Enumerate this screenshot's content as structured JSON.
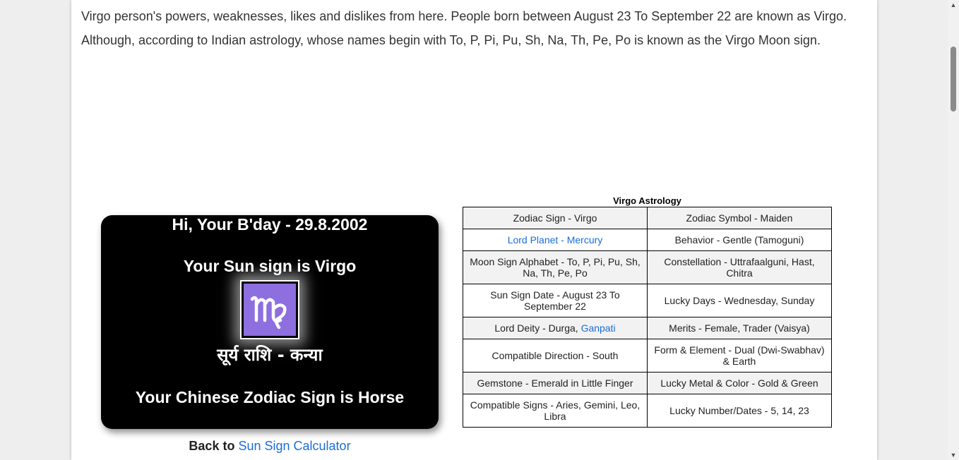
{
  "intro": {
    "text": "Virgo person's powers, weaknesses, likes and dislikes from here. People born between August 23 To September 22 are known as Virgo. Although, according to Indian astrology, whose names begin with To, P, Pi, Pu, Sh, Na, Th, Pe, Po is known as the Virgo Moon sign."
  },
  "card": {
    "birthday": "Hi, Your B'day - 29.8.2002",
    "sun_sign": "Your Sun sign is Virgo",
    "symbol_icon": "virgo-symbol-icon",
    "hindi": "सूर्य राशि - कन्या",
    "chinese": "Your Chinese Zodiac Sign is Horse",
    "symbol_color": "#8d6fe0"
  },
  "back": {
    "prefix": "Back to",
    "link": "Sun Sign Calculator"
  },
  "table": {
    "caption": "Virgo Astrology",
    "rows": [
      {
        "left": "Zodiac Sign - Virgo",
        "right": "Zodiac Symbol - Maiden"
      },
      {
        "left": "Lord Planet - Mercury",
        "right": "Behavior - Gentle (Tamoguni)"
      },
      {
        "left": "Moon Sign Alphabet - To, P, Pi, Pu, Sh, Na, Th, Pe, Po",
        "right": "Constellation - Uttrafaalguni, Hast, Chitra"
      },
      {
        "left": "Sun Sign Date - August 23 To September 22",
        "right": "Lucky Days - Wednesday, Sunday"
      },
      {
        "left_prefix": "Lord Deity - Durga,",
        "left_link": "Ganpati",
        "right": "Merits - Female, Trader (Vaisya)"
      },
      {
        "left": "Compatible Direction - South",
        "right": "Form & Element - Dual (Dwi-Swabhav) & Earth"
      },
      {
        "left": "Gemstone - Emerald in Little Finger",
        "right": "Lucky Metal & Color - Gold & Green"
      },
      {
        "left": "Compatible Signs - Aries, Gemini, Leo, Libra",
        "right": "Lucky Number/Dates - 5, 14, 23"
      }
    ]
  },
  "colors": {
    "link": "#1a6ed8",
    "card_bg": "#000000"
  }
}
